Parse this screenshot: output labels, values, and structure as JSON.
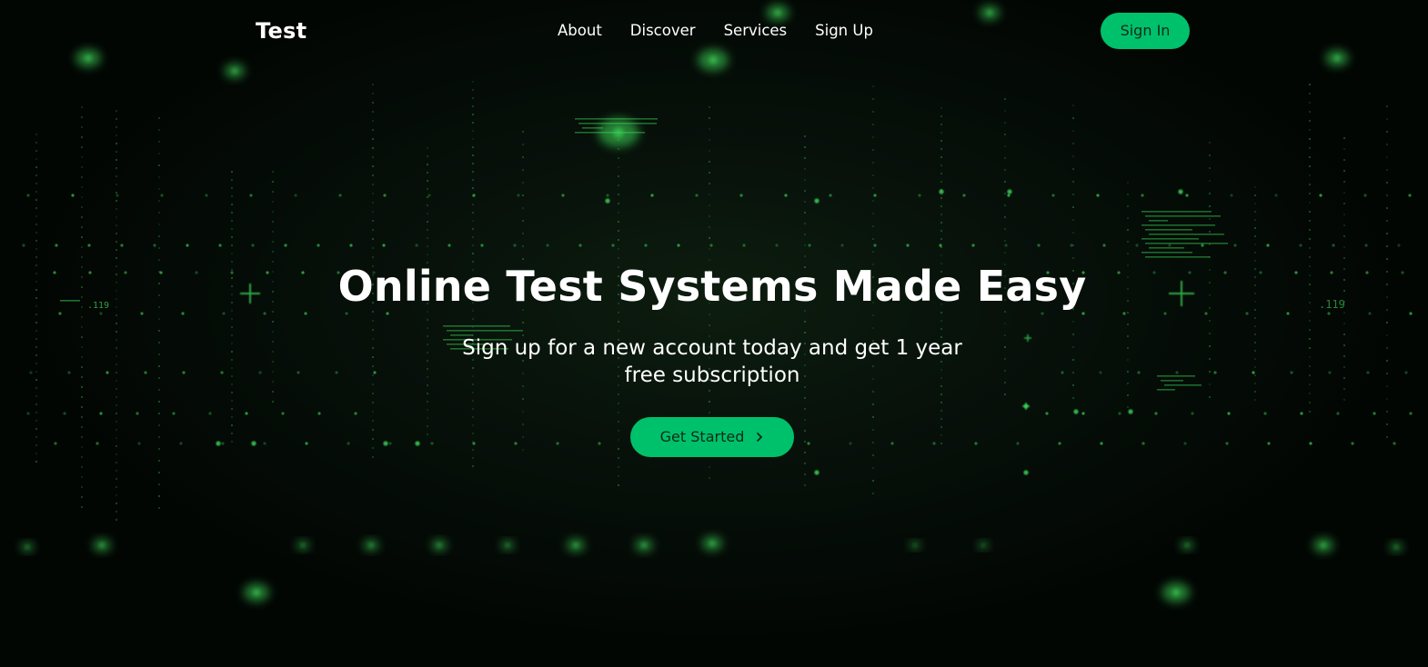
{
  "navbar": {
    "brand": "Test",
    "links": [
      {
        "label": "About"
      },
      {
        "label": "Discover"
      },
      {
        "label": "Services"
      },
      {
        "label": "Sign Up"
      }
    ],
    "signin_label": "Sign In"
  },
  "hero": {
    "title": "Online Test Systems Made Easy",
    "subtitle": "Sign up for a new account today and get 1 year free subscription",
    "cta_label": "Get Started",
    "cta_icon": "chevron-right-icon"
  },
  "background": {
    "code_label_left": ".119",
    "code_label_right": ".119"
  },
  "colors": {
    "accent": "#00c16b",
    "background": "#020603",
    "glow": "#3fdc5a",
    "text": "#ffffff"
  }
}
